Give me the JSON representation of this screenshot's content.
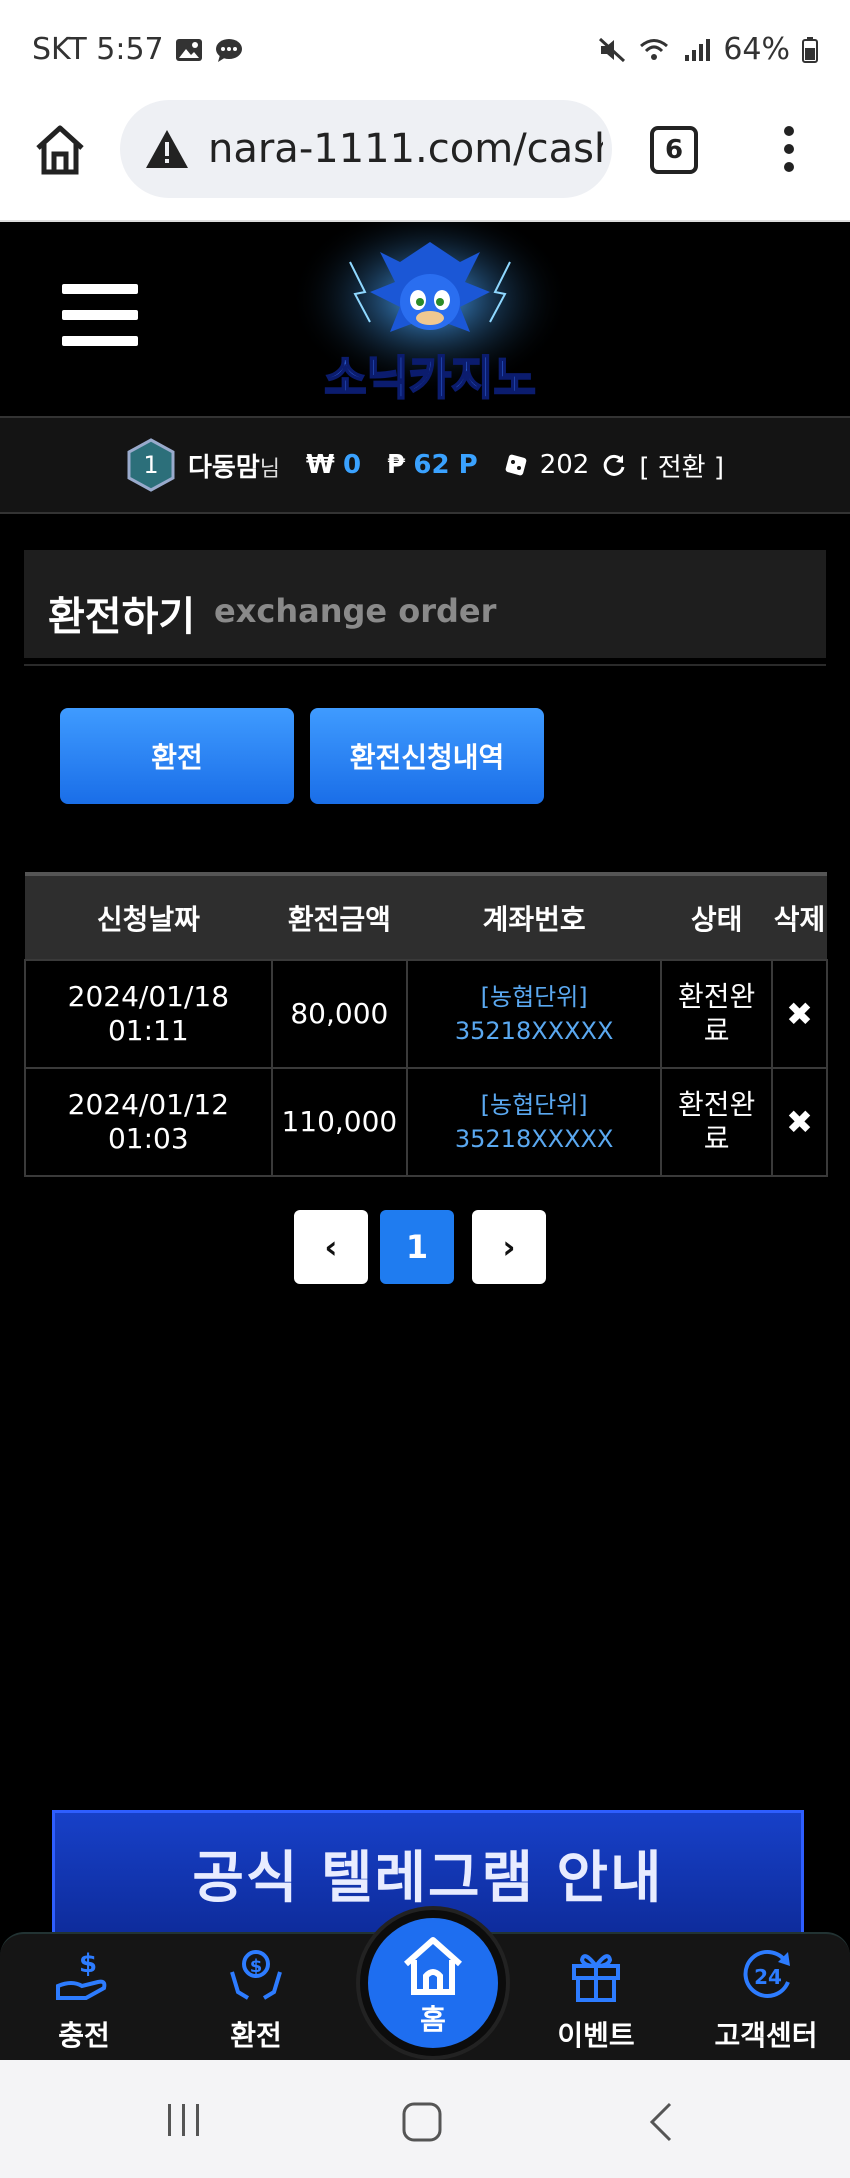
{
  "status_bar": {
    "carrier_time": "SKT 5:57",
    "battery": "64%"
  },
  "browser": {
    "url": "nara-1111.com/cash_",
    "tab_count": "6"
  },
  "site": {
    "logo_text": "소닉카지노"
  },
  "user": {
    "level": "1",
    "name": "다동맘",
    "suffix": "님",
    "won_symbol": "₩",
    "won_value": "0",
    "point_symbol": "₱",
    "point_value": "62 P",
    "chip_value": "202",
    "convert_label": "[ 전환 ]"
  },
  "panel": {
    "title": "환전하기",
    "subtitle": "exchange order"
  },
  "buttons": {
    "exchange": "환전",
    "history": "환전신청내역"
  },
  "table": {
    "headers": [
      "신청날짜",
      "환전금액",
      "계좌번호",
      "상태",
      "삭제"
    ],
    "rows": [
      {
        "date": "2024/01/18",
        "time": "01:11",
        "amount": "80,000",
        "bank": "[농협단위]",
        "account": "35218XXXXX",
        "status1": "환전완",
        "status2": "료",
        "delete": "✖"
      },
      {
        "date": "2024/01/12",
        "time": "01:03",
        "amount": "110,000",
        "bank": "[농협단위]",
        "account": "35218XXXXX",
        "status1": "환전완",
        "status2": "료",
        "delete": "✖"
      }
    ]
  },
  "pager": {
    "prev": "‹",
    "current": "1",
    "next": "›"
  },
  "banner": {
    "text": "공식 텔레그램 안내"
  },
  "bottom_nav": {
    "charge": "충전",
    "exchange": "환전",
    "home": "홈",
    "event": "이벤트",
    "support": "고객센터"
  },
  "colors": {
    "accent_blue": "#1f7cf0",
    "link_blue": "#5aa8f0"
  }
}
